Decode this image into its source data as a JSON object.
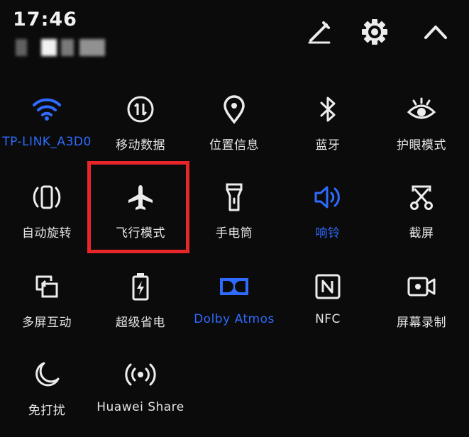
{
  "status_bar": {
    "time": "17:46"
  },
  "colors": {
    "active": "#2f6bff",
    "icon": "#ececec",
    "highlight": "#e8262a",
    "background": "#0b0b0b"
  },
  "top_actions": [
    {
      "name": "edit-pencil-icon"
    },
    {
      "name": "gear-icon"
    },
    {
      "name": "chevron-up-icon"
    }
  ],
  "tiles": [
    {
      "id": "wifi",
      "label": "TP-LINK_A3D0",
      "icon": "wifi-icon",
      "active": true
    },
    {
      "id": "mobile-data",
      "label": "移动数据",
      "icon": "mobile-data-icon",
      "active": false
    },
    {
      "id": "location",
      "label": "位置信息",
      "icon": "location-pin-icon",
      "active": false
    },
    {
      "id": "bluetooth",
      "label": "蓝牙",
      "icon": "bluetooth-icon",
      "active": false
    },
    {
      "id": "eye-comfort",
      "label": "护眼模式",
      "icon": "eye-icon",
      "active": false
    },
    {
      "id": "auto-rotate",
      "label": "自动旋转",
      "icon": "rotate-icon",
      "active": false
    },
    {
      "id": "airplane-mode",
      "label": "飞行模式",
      "icon": "airplane-icon",
      "active": false
    },
    {
      "id": "flashlight",
      "label": "手电筒",
      "icon": "flashlight-icon",
      "active": false
    },
    {
      "id": "ring",
      "label": "响铃",
      "icon": "speaker-icon",
      "active": true
    },
    {
      "id": "screenshot",
      "label": "截屏",
      "icon": "scissors-icon",
      "active": false
    },
    {
      "id": "multi-screen",
      "label": "多屏互动",
      "icon": "multi-screen-icon",
      "active": false
    },
    {
      "id": "power-saver",
      "label": "超级省电",
      "icon": "battery-icon",
      "active": false
    },
    {
      "id": "dolby",
      "label": "Dolby Atmos",
      "icon": "dolby-icon",
      "active": true
    },
    {
      "id": "nfc",
      "label": "NFC",
      "icon": "nfc-icon",
      "active": false
    },
    {
      "id": "screen-record",
      "label": "屏幕录制",
      "icon": "camera-record-icon",
      "active": false
    },
    {
      "id": "dnd",
      "label": "免打扰",
      "icon": "moon-icon",
      "active": false
    },
    {
      "id": "huawei-share",
      "label": "Huawei Share",
      "icon": "share-wave-icon",
      "active": false
    }
  ]
}
